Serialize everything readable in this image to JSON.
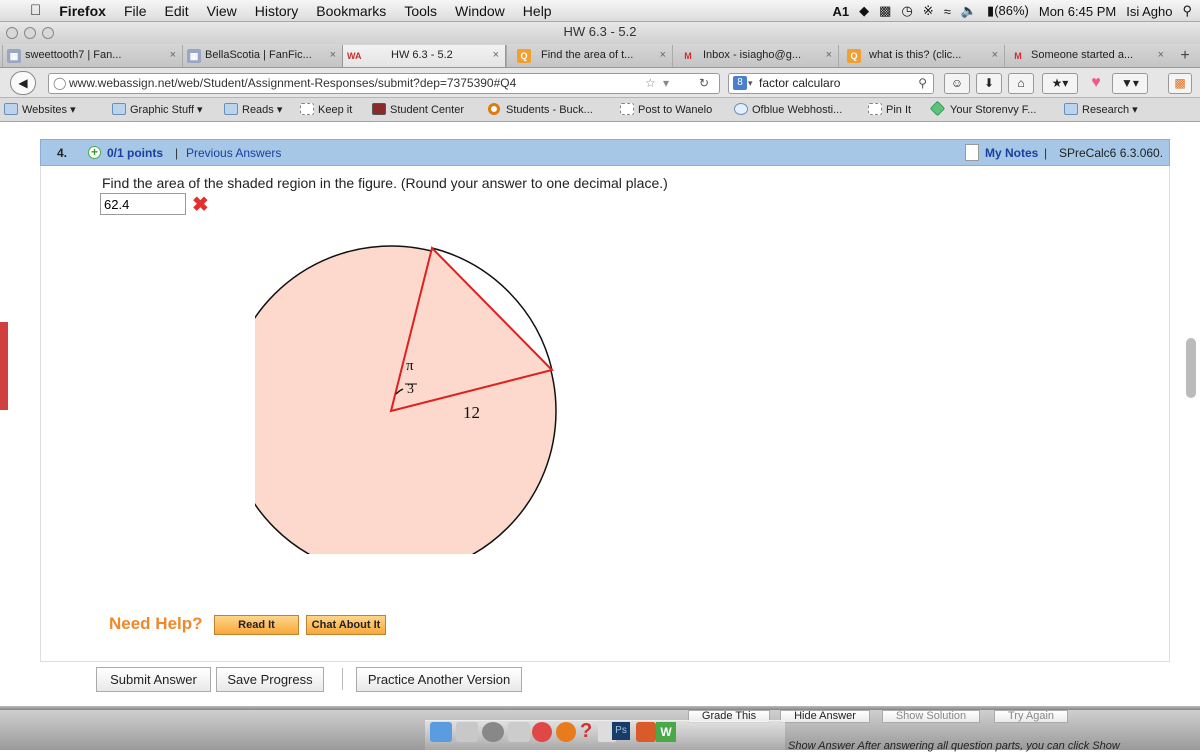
{
  "menubar": {
    "app": "Firefox",
    "items": [
      "File",
      "Edit",
      "View",
      "History",
      "Bookmarks",
      "Tools",
      "Window",
      "Help"
    ],
    "status": {
      "adobe": "1",
      "battery": "(86%)",
      "clock": "Mon 6:45 PM",
      "user": "Isi Agho"
    }
  },
  "window": {
    "title": "HW 6.3 - 5.2"
  },
  "tabs": [
    {
      "label": "sweettooth7 | Fan...",
      "icon": "FF"
    },
    {
      "label": "BellaScotia | FanFic...",
      "icon": "FF"
    },
    {
      "label": "HW 6.3 - 5.2",
      "icon": "WA"
    },
    {
      "label": "Find the area of t...",
      "icon": "Q"
    },
    {
      "label": "Inbox - isiagho@g...",
      "icon": "M"
    },
    {
      "label": "what is this? (clic...",
      "icon": "Q"
    },
    {
      "label": "Someone started a...",
      "icon": "M"
    }
  ],
  "nav": {
    "url": "www.webassign.net/web/Student/Assignment-Responses/submit?dep=7375390#Q4",
    "search": "factor calcularo"
  },
  "bookmarks": [
    "Websites",
    "Graphic Stuff",
    "Reads",
    "Keep it",
    "Student Center",
    "Students - Buck...",
    "Post to Wanelo",
    "Ofblue Webhosti...",
    "Pin It",
    "Your Storenvy F...",
    "Research"
  ],
  "question": {
    "number": "4.",
    "points": "0/1 points",
    "separator": "|",
    "previous": "Previous Answers",
    "my_notes": "My Notes",
    "course_ref": "SPreCalc6 6.3.060.",
    "prompt": "Find the area of the shaded region in the figure. (Round your answer to one decimal place.)",
    "answer": "62.4",
    "figure": {
      "angle_num": "π",
      "angle_den": "3",
      "radius_label": "12"
    }
  },
  "help": {
    "label": "Need Help?",
    "read_it": "Read It",
    "chat": "Chat About It"
  },
  "actions": {
    "submit": "Submit Answer",
    "save": "Save Progress",
    "practice": "Practice Another Version"
  },
  "underlay": {
    "grade": "Grade This",
    "hide": "Hide Answer",
    "show_solution": "Show Solution",
    "try_again": "Try Again",
    "footer": "Show Answer After answering all question parts, you can click Show"
  },
  "colors": {
    "accent_blue": "#a6c7e6",
    "shade": "#fcd9cc",
    "triangle": "#e02020",
    "help_orange": "#f0882a",
    "wrong": "#e03030"
  }
}
